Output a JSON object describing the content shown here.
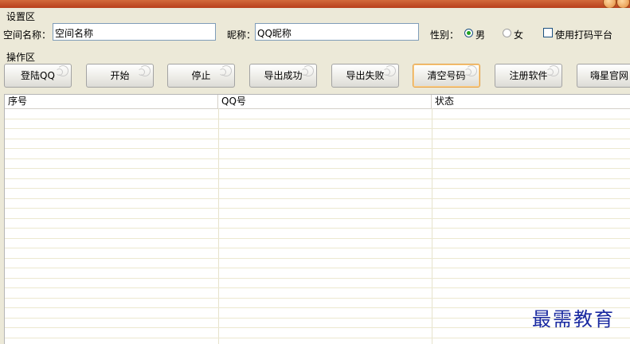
{
  "settings": {
    "group_label": "设置区",
    "space_name_label": "空间名称：",
    "space_name_value": "空间名称",
    "nickname_label": "昵称：",
    "nickname_value": "QQ昵称",
    "gender_label": "性别：",
    "gender_male": "男",
    "gender_female": "女",
    "gender_selected": "男",
    "captcha_label": "使用打码平台",
    "captcha_checked": false
  },
  "operations": {
    "group_label": "操作区",
    "buttons": [
      {
        "label": "登陆QQ"
      },
      {
        "label": "开始"
      },
      {
        "label": "停止"
      },
      {
        "label": "导出成功"
      },
      {
        "label": "导出失败"
      },
      {
        "label": "清空号码"
      },
      {
        "label": "注册软件"
      },
      {
        "label": "嗨星官网"
      }
    ]
  },
  "table": {
    "columns": [
      "序号",
      "QQ号",
      "状态"
    ],
    "rows": []
  },
  "watermark": "最需教育"
}
